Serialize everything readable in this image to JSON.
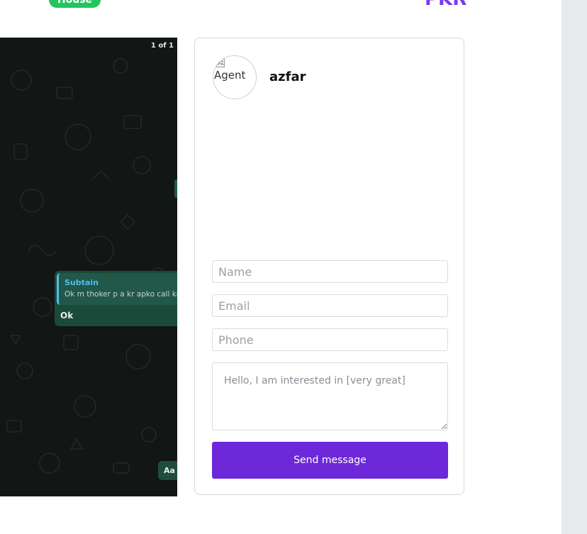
{
  "listing": {
    "badge_label": "House",
    "currency_label": "PKR"
  },
  "gallery": {
    "page_counter": "1 of 1",
    "chat": {
      "quoted_sender": "Subtain",
      "quoted_message": "Ok m thoker p a kr apko call krta",
      "reply_message": "Ok",
      "bottom_message": "Aa b"
    }
  },
  "agent": {
    "avatar_alt": "Agent",
    "name": "azfar"
  },
  "contact_form": {
    "name_placeholder": "Name",
    "email_placeholder": "Email",
    "phone_placeholder": "Phone",
    "message_placeholder": "Hello, I am interested in [very great]",
    "submit_label": "Send message"
  },
  "colors": {
    "badge_green": "#22c55e",
    "price_purple": "#7c3aed",
    "button_purple": "#6d28d9",
    "chat_background": "#121614"
  }
}
